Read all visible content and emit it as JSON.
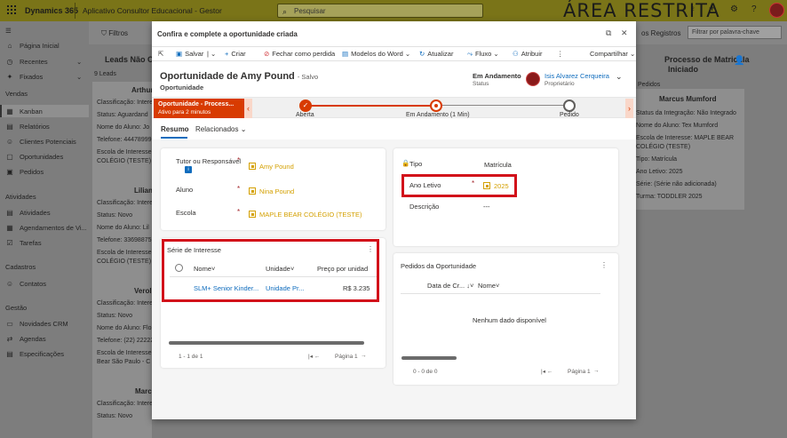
{
  "topbar": {
    "brand": "Dynamics 365",
    "app": "Aplicativo Consultor Educacional - Gestor",
    "search_placeholder": "Pesquisar",
    "banner": "ÁREA RESTRITA"
  },
  "sidebar": {
    "items": [
      {
        "label": "Página Inicial",
        "icon": "home-icon"
      },
      {
        "label": "Recentes",
        "icon": "clock-icon"
      },
      {
        "label": "Fixados",
        "icon": "pin-icon"
      }
    ],
    "sections": [
      {
        "title": "Vendas",
        "items": [
          "Kanban",
          "Relatórios",
          "Clientes Potenciais",
          "Oportunidades",
          "Pedidos"
        ]
      },
      {
        "title": "Atividades",
        "items": [
          "Atividades",
          "Agendamentos de Vi...",
          "Tarefas"
        ]
      },
      {
        "title": "Cadastros",
        "items": [
          "Contatos"
        ]
      },
      {
        "title": "Gestão",
        "items": [
          "Novidades CRM",
          "Agendas",
          "Especificações"
        ]
      }
    ]
  },
  "background": {
    "filters_label": "Filtros",
    "registros_label": "os Registros",
    "filter_placeholder": "Filtrar por palavra-chave",
    "left_column": {
      "title": "Leads Não C",
      "count": "9 Leads",
      "card1": {
        "name": "Arthur",
        "lines": [
          "Classificação: Intere",
          "Status: Aguardand",
          "Nome do Aluno: Jo",
          "Telefone: 44478999",
          "Escola de Interesse:",
          "COLÉGIO (TESTE)"
        ]
      },
      "card2": {
        "name": "Lilian",
        "lines": [
          "Classificação: Intere",
          "Status: Novo",
          "Nome do Aluno: Lil",
          "Telefone: 33698875",
          "Escola de Interesse:",
          "COLÉGIO (TESTE)"
        ]
      },
      "card3": {
        "name": "Verol",
        "lines": [
          "Classificação: Intere",
          "Status: Novo",
          "Nome do Aluno: Flo",
          "Telefone: (22) 22222",
          "Escola de Interesse:",
          "Bear São Paulo - C"
        ]
      },
      "card4": {
        "name": "Marco",
        "lines": [
          "Classificação: Intere",
          "Status: Novo"
        ]
      }
    },
    "right_column": {
      "title": "Processo de Matricula Iniciado",
      "subtitle": "Pedidos",
      "card": {
        "name": "Marcus Mumford",
        "lines": [
          "Status da Integração: Não Integrado",
          "Nome do Aluno: Tex Mumford",
          "Escola de Interesse: MAPLE BEAR",
          "COLÉGIO (TESTE)",
          "Tipo: Matrícula",
          "Ano Letivo: 2025",
          "Série: (Série não adicionada)",
          "Turma: TODDLER 2025"
        ]
      }
    }
  },
  "dialog": {
    "title": "Confira e complete a oportunidade criada",
    "commands": [
      "Salvar",
      "Criar",
      "Fechar como perdida",
      "Modelos do Word",
      "Atualizar",
      "Fluxo",
      "Atribuir",
      "Compartilhar"
    ],
    "record": {
      "title": "Oportunidade de Amy Pound",
      "saved": "- Salvo",
      "type": "Oportunidade",
      "status_value": "Em Andamento",
      "status_label": "Status",
      "owner_name": "Isis Alvarez Cerqueira",
      "owner_label": "Proprietário"
    },
    "bpf": {
      "active_title": "Oportunidade - Process...",
      "active_sub": "Ativo para 2 minutos",
      "stages": [
        "Aberta",
        "Em Andamento  (1 Min)",
        "Pedido"
      ]
    },
    "tabs": [
      "Resumo",
      "Relacionados"
    ],
    "main_fields": [
      {
        "label": "Tutor ou Responsável",
        "value": "Amy Pound"
      },
      {
        "label": "Aluno",
        "value": "Nina Pound"
      },
      {
        "label": "Escola",
        "value": "MAPLE BEAR COLÉGIO (TESTE)"
      }
    ],
    "serie_grid": {
      "title": "Série de Interesse",
      "columns": [
        "Nome",
        "Unidade",
        "Preço por unidad"
      ],
      "rows": [
        {
          "nome": "SLM+ Senior Kinder...",
          "unidade": "Unidade Pr...",
          "preco": "R$ 3.235"
        }
      ],
      "footer": "1 - 1 de 1",
      "page": "Página 1"
    },
    "side_fields": [
      {
        "label": "Tipo",
        "value": "Matrícula"
      },
      {
        "label": "Ano Letivo",
        "value": "2025"
      },
      {
        "label": "Descrição",
        "value": "---"
      }
    ],
    "pedidos_grid": {
      "title": "Pedidos da Oportunidade",
      "columns": [
        "Data de Cr...",
        "Nome"
      ],
      "empty": "Nenhum dado disponível",
      "footer": "0 - 0 de 0",
      "page": "Página 1"
    }
  }
}
